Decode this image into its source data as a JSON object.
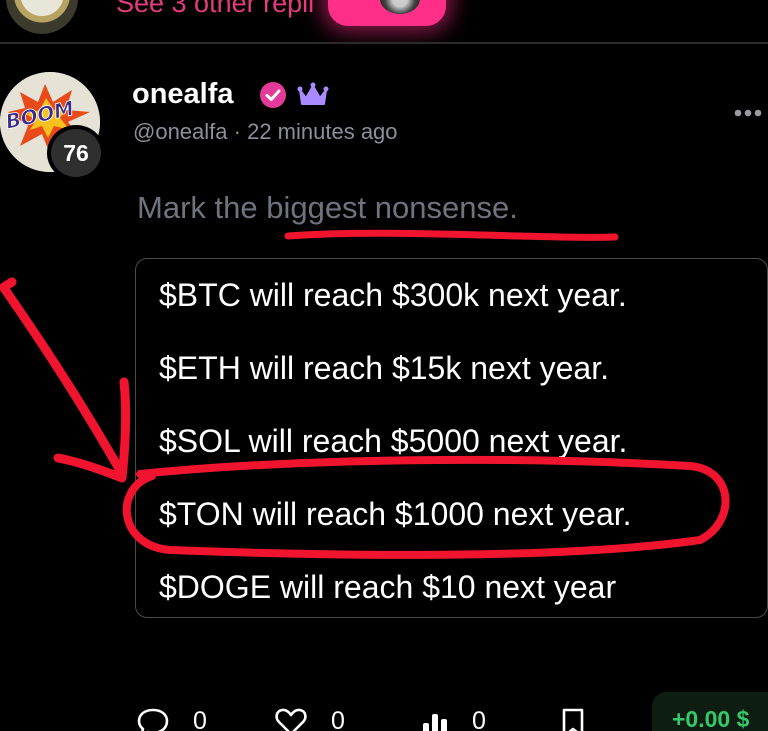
{
  "top": {
    "replies_text": "See 3 other repli"
  },
  "post": {
    "username": "onealfa",
    "handle": "@onealfa",
    "separator": "·",
    "time_ago": "22 minutes ago",
    "level": "76",
    "avatar_text": "BOOM",
    "question": "Mark the biggest nonsense.",
    "options": [
      "$BTC will reach $300k next year.",
      "$ETH will reach $15k next year.",
      "$SOL will reach $5000 next year.",
      "$TON will reach $1000 next year.",
      "$DOGE will reach $10 next year"
    ]
  },
  "actions": {
    "comments": "0",
    "likes": "0",
    "views": "0",
    "tip": "+0.00 $"
  },
  "icons": [
    "verified-icon",
    "crown-icon",
    "more-icon",
    "comment-icon",
    "heart-icon",
    "stats-icon",
    "bookmark-icon"
  ],
  "colors": {
    "accent_pink": "#ff2e86",
    "verified": "#e43b9a",
    "crown": "#a98bff",
    "tip_green": "#34c86a",
    "annotation_red": "#f0142e"
  }
}
